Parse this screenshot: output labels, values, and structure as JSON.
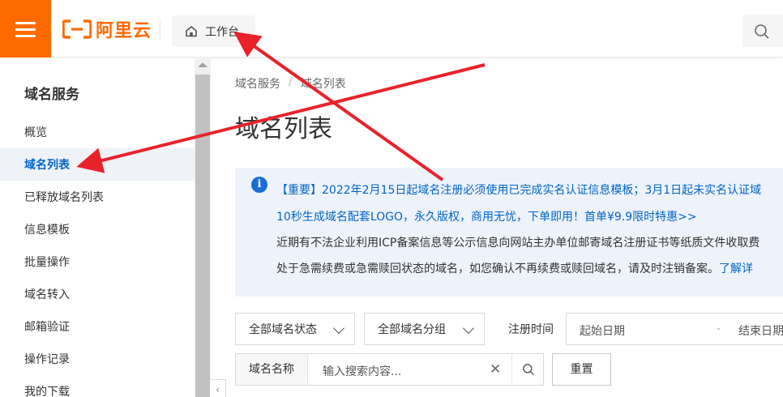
{
  "header": {
    "logo_text": "阿里云",
    "workbench_label": "工作台",
    "search_icon": "search-icon",
    "brand_color": "#ff6a00"
  },
  "sidebar": {
    "title": "域名服务",
    "items": [
      {
        "label": "概览",
        "active": false
      },
      {
        "label": "域名列表",
        "active": true
      },
      {
        "label": "已释放域名列表",
        "active": false
      },
      {
        "label": "信息模板",
        "active": false
      },
      {
        "label": "批量操作",
        "active": false
      },
      {
        "label": "域名转入",
        "active": false
      },
      {
        "label": "邮箱验证",
        "active": false
      },
      {
        "label": "操作记录",
        "active": false
      },
      {
        "label": "我的下载",
        "active": false
      }
    ],
    "collapse_icon": "chevron-left-icon"
  },
  "breadcrumb": {
    "items": [
      "域名服务",
      "域名列表"
    ],
    "separator": "/"
  },
  "page_title": "域名列表",
  "notice": {
    "line1": "【重要】2022年2月15日起域名注册必须使用已完成实名认证信息模板；3月1日起未实名认证域",
    "line2": "10秒生成域名配套LOGO，永久版权，商用无忧，下单即用！首单¥9.9限时特惠>>",
    "line3": "近期有不法企业利用ICP备案信息等公示信息向网站主办单位邮寄域名注册证书等纸质文件收取费",
    "line4_text": "处于急需续费或急需赎回状态的域名，如您确认不再续费或赎回域名，请及时注销备案。",
    "line4_link": "了解详",
    "icon": "info-icon",
    "accent_color": "#0064c8"
  },
  "filters": {
    "status_select": "全部域名状态",
    "group_select": "全部域名分组",
    "reg_time_label": "注册时间",
    "start_date": "起始日期",
    "date_separator": "-",
    "end_date": "结束日期"
  },
  "search": {
    "prefix": "域名名称",
    "placeholder": "输入搜索内容...",
    "clear_icon": "close-icon",
    "button_icon": "search-icon",
    "reset_label": "重置"
  }
}
